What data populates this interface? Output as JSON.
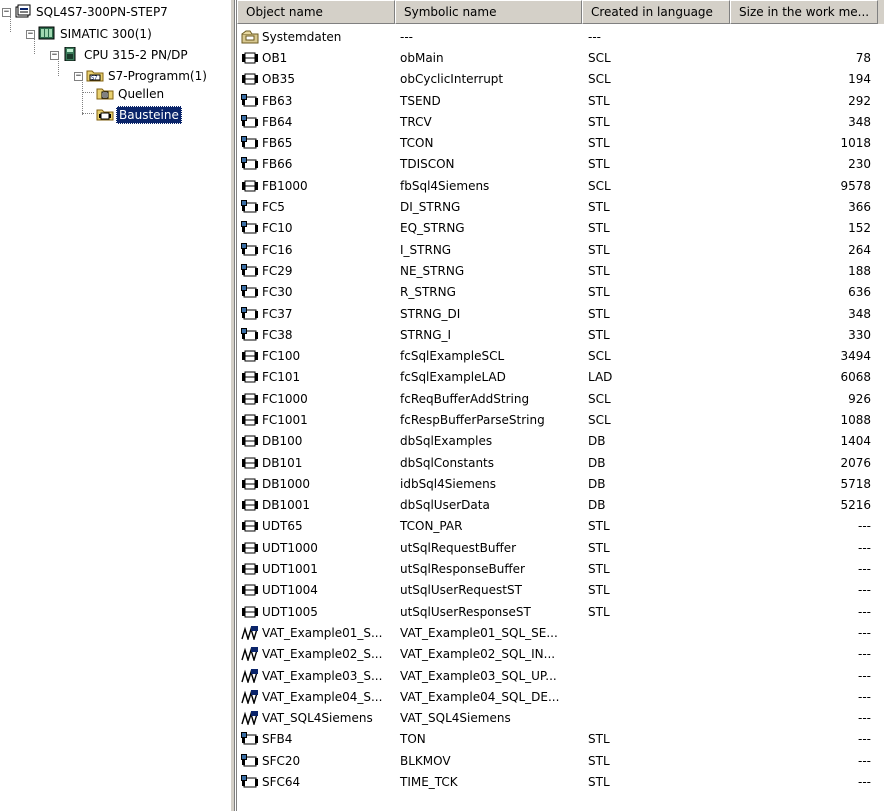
{
  "tree": {
    "nodes": [
      {
        "label": "SQL4S7-300PN-STEP7",
        "icon": "project-icon",
        "expander": "−"
      },
      {
        "label": "SIMATIC 300(1)",
        "icon": "station-icon",
        "expander": "−"
      },
      {
        "label": "CPU 315-2 PN/DP",
        "icon": "cpu-icon",
        "expander": "−"
      },
      {
        "label": "S7-Programm(1)",
        "icon": "program-folder-icon",
        "expander": "−"
      },
      {
        "label": "Quellen",
        "icon": "sources-folder-icon"
      },
      {
        "label": "Bausteine",
        "icon": "blocks-folder-icon",
        "selected": true
      }
    ]
  },
  "list": {
    "columns": [
      "Object name",
      "Symbolic name",
      "Created in language",
      "Size in the work me..."
    ],
    "rows": [
      {
        "name": "Systemdaten",
        "symbol": "---",
        "lang": "---",
        "size": "",
        "icon": "system-data-icon"
      },
      {
        "name": "OB1",
        "symbol": "obMain",
        "lang": "SCL",
        "size": "78",
        "icon": "block-icon"
      },
      {
        "name": "OB35",
        "symbol": "obCyclicInterrupt",
        "lang": "SCL",
        "size": "194",
        "icon": "block-icon"
      },
      {
        "name": "FB63",
        "symbol": "TSEND",
        "lang": "STL",
        "size": "292",
        "icon": "protected-block-icon"
      },
      {
        "name": "FB64",
        "symbol": "TRCV",
        "lang": "STL",
        "size": "348",
        "icon": "protected-block-icon"
      },
      {
        "name": "FB65",
        "symbol": "TCON",
        "lang": "STL",
        "size": "1018",
        "icon": "protected-block-icon"
      },
      {
        "name": "FB66",
        "symbol": "TDISCON",
        "lang": "STL",
        "size": "230",
        "icon": "protected-block-icon"
      },
      {
        "name": "FB1000",
        "symbol": "fbSql4Siemens",
        "lang": "SCL",
        "size": "9578",
        "icon": "block-icon"
      },
      {
        "name": "FC5",
        "symbol": "DI_STRNG",
        "lang": "STL",
        "size": "366",
        "icon": "protected-block-icon"
      },
      {
        "name": "FC10",
        "symbol": "EQ_STRNG",
        "lang": "STL",
        "size": "152",
        "icon": "protected-block-icon"
      },
      {
        "name": "FC16",
        "symbol": "I_STRNG",
        "lang": "STL",
        "size": "264",
        "icon": "protected-block-icon"
      },
      {
        "name": "FC29",
        "symbol": "NE_STRNG",
        "lang": "STL",
        "size": "188",
        "icon": "protected-block-icon"
      },
      {
        "name": "FC30",
        "symbol": "R_STRNG",
        "lang": "STL",
        "size": "636",
        "icon": "protected-block-icon"
      },
      {
        "name": "FC37",
        "symbol": "STRNG_DI",
        "lang": "STL",
        "size": "348",
        "icon": "protected-block-icon"
      },
      {
        "name": "FC38",
        "symbol": "STRNG_I",
        "lang": "STL",
        "size": "330",
        "icon": "protected-block-icon"
      },
      {
        "name": "FC100",
        "symbol": "fcSqlExampleSCL",
        "lang": "SCL",
        "size": "3494",
        "icon": "block-icon"
      },
      {
        "name": "FC101",
        "symbol": "fcSqlExampleLAD",
        "lang": "LAD",
        "size": "6068",
        "icon": "block-icon"
      },
      {
        "name": "FC1000",
        "symbol": "fcReqBufferAddString",
        "lang": "SCL",
        "size": "926",
        "icon": "block-icon"
      },
      {
        "name": "FC1001",
        "symbol": "fcRespBufferParseString",
        "lang": "SCL",
        "size": "1088",
        "icon": "block-icon"
      },
      {
        "name": "DB100",
        "symbol": "dbSqlExamples",
        "lang": "DB",
        "size": "1404",
        "icon": "block-icon"
      },
      {
        "name": "DB101",
        "symbol": "dbSqlConstants",
        "lang": "DB",
        "size": "2076",
        "icon": "block-icon"
      },
      {
        "name": "DB1000",
        "symbol": "idbSql4Siemens",
        "lang": "DB",
        "size": "5718",
        "icon": "block-icon"
      },
      {
        "name": "DB1001",
        "symbol": "dbSqlUserData",
        "lang": "DB",
        "size": "5216",
        "icon": "block-icon"
      },
      {
        "name": "UDT65",
        "symbol": "TCON_PAR",
        "lang": "STL",
        "size": "---",
        "icon": "block-icon"
      },
      {
        "name": "UDT1000",
        "symbol": "utSqlRequestBuffer",
        "lang": "STL",
        "size": "---",
        "icon": "block-icon"
      },
      {
        "name": "UDT1001",
        "symbol": "utSqlResponseBuffer",
        "lang": "STL",
        "size": "---",
        "icon": "block-icon"
      },
      {
        "name": "UDT1004",
        "symbol": "utSqlUserRequestST",
        "lang": "STL",
        "size": "---",
        "icon": "block-icon"
      },
      {
        "name": "UDT1005",
        "symbol": "utSqlUserResponseST",
        "lang": "STL",
        "size": "---",
        "icon": "block-icon"
      },
      {
        "name": "VAT_Example01_S...",
        "symbol": "VAT_Example01_SQL_SE...",
        "lang": "",
        "size": "---",
        "icon": "vat-icon"
      },
      {
        "name": "VAT_Example02_S...",
        "symbol": "VAT_Example02_SQL_IN...",
        "lang": "",
        "size": "---",
        "icon": "vat-icon"
      },
      {
        "name": "VAT_Example03_S...",
        "symbol": "VAT_Example03_SQL_UP...",
        "lang": "",
        "size": "---",
        "icon": "vat-icon"
      },
      {
        "name": "VAT_Example04_S...",
        "symbol": "VAT_Example04_SQL_DE...",
        "lang": "",
        "size": "---",
        "icon": "vat-icon"
      },
      {
        "name": "VAT_SQL4Siemens",
        "symbol": "VAT_SQL4Siemens",
        "lang": "",
        "size": "---",
        "icon": "vat-icon"
      },
      {
        "name": "SFB4",
        "symbol": "TON",
        "lang": "STL",
        "size": "---",
        "icon": "protected-block-icon"
      },
      {
        "name": "SFC20",
        "symbol": "BLKMOV",
        "lang": "STL",
        "size": "---",
        "icon": "protected-block-icon"
      },
      {
        "name": "SFC64",
        "symbol": "TIME_TCK",
        "lang": "STL",
        "size": "---",
        "icon": "protected-block-icon"
      }
    ]
  },
  "colors": {
    "selection": "#0a246a",
    "chrome": "#d4d0c8"
  }
}
